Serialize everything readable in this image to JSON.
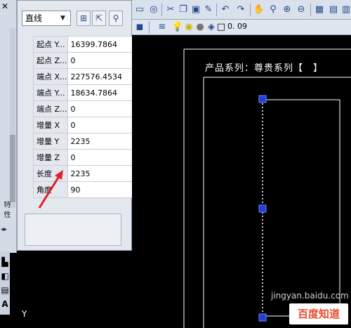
{
  "palette": {
    "object_type": "直线",
    "description_text": "",
    "rows": [
      {
        "key": "起点 Y...",
        "value": "16399.7864"
      },
      {
        "key": "起点 Z...",
        "value": "0"
      },
      {
        "key": "端点 X...",
        "value": "227576.4534"
      },
      {
        "key": "端点 Y...",
        "value": "18634.7864"
      },
      {
        "key": "端点 Z...",
        "value": "0"
      },
      {
        "key": "增量 X",
        "value": "0"
      },
      {
        "key": "增量 Y",
        "value": "2235"
      },
      {
        "key": "增量 Z",
        "value": "0"
      },
      {
        "key": "长度",
        "value": "2235"
      },
      {
        "key": "角度",
        "value": "90"
      }
    ]
  },
  "left_strip": {
    "label_top": "特",
    "label_bottom": "性",
    "close": "✕"
  },
  "layer_toolbar": {
    "lineweight_text": "0. 09"
  },
  "drawing": {
    "title_text": "产品系列：尊贵系列【　】",
    "ucs_label": "Y",
    "watermark_text": "jingyan.baidu.com",
    "logo_text": "百度知道"
  },
  "colors": {
    "grip": "#1f3fd6",
    "annotation": "#e0202a",
    "line_white": "#ffffff"
  }
}
